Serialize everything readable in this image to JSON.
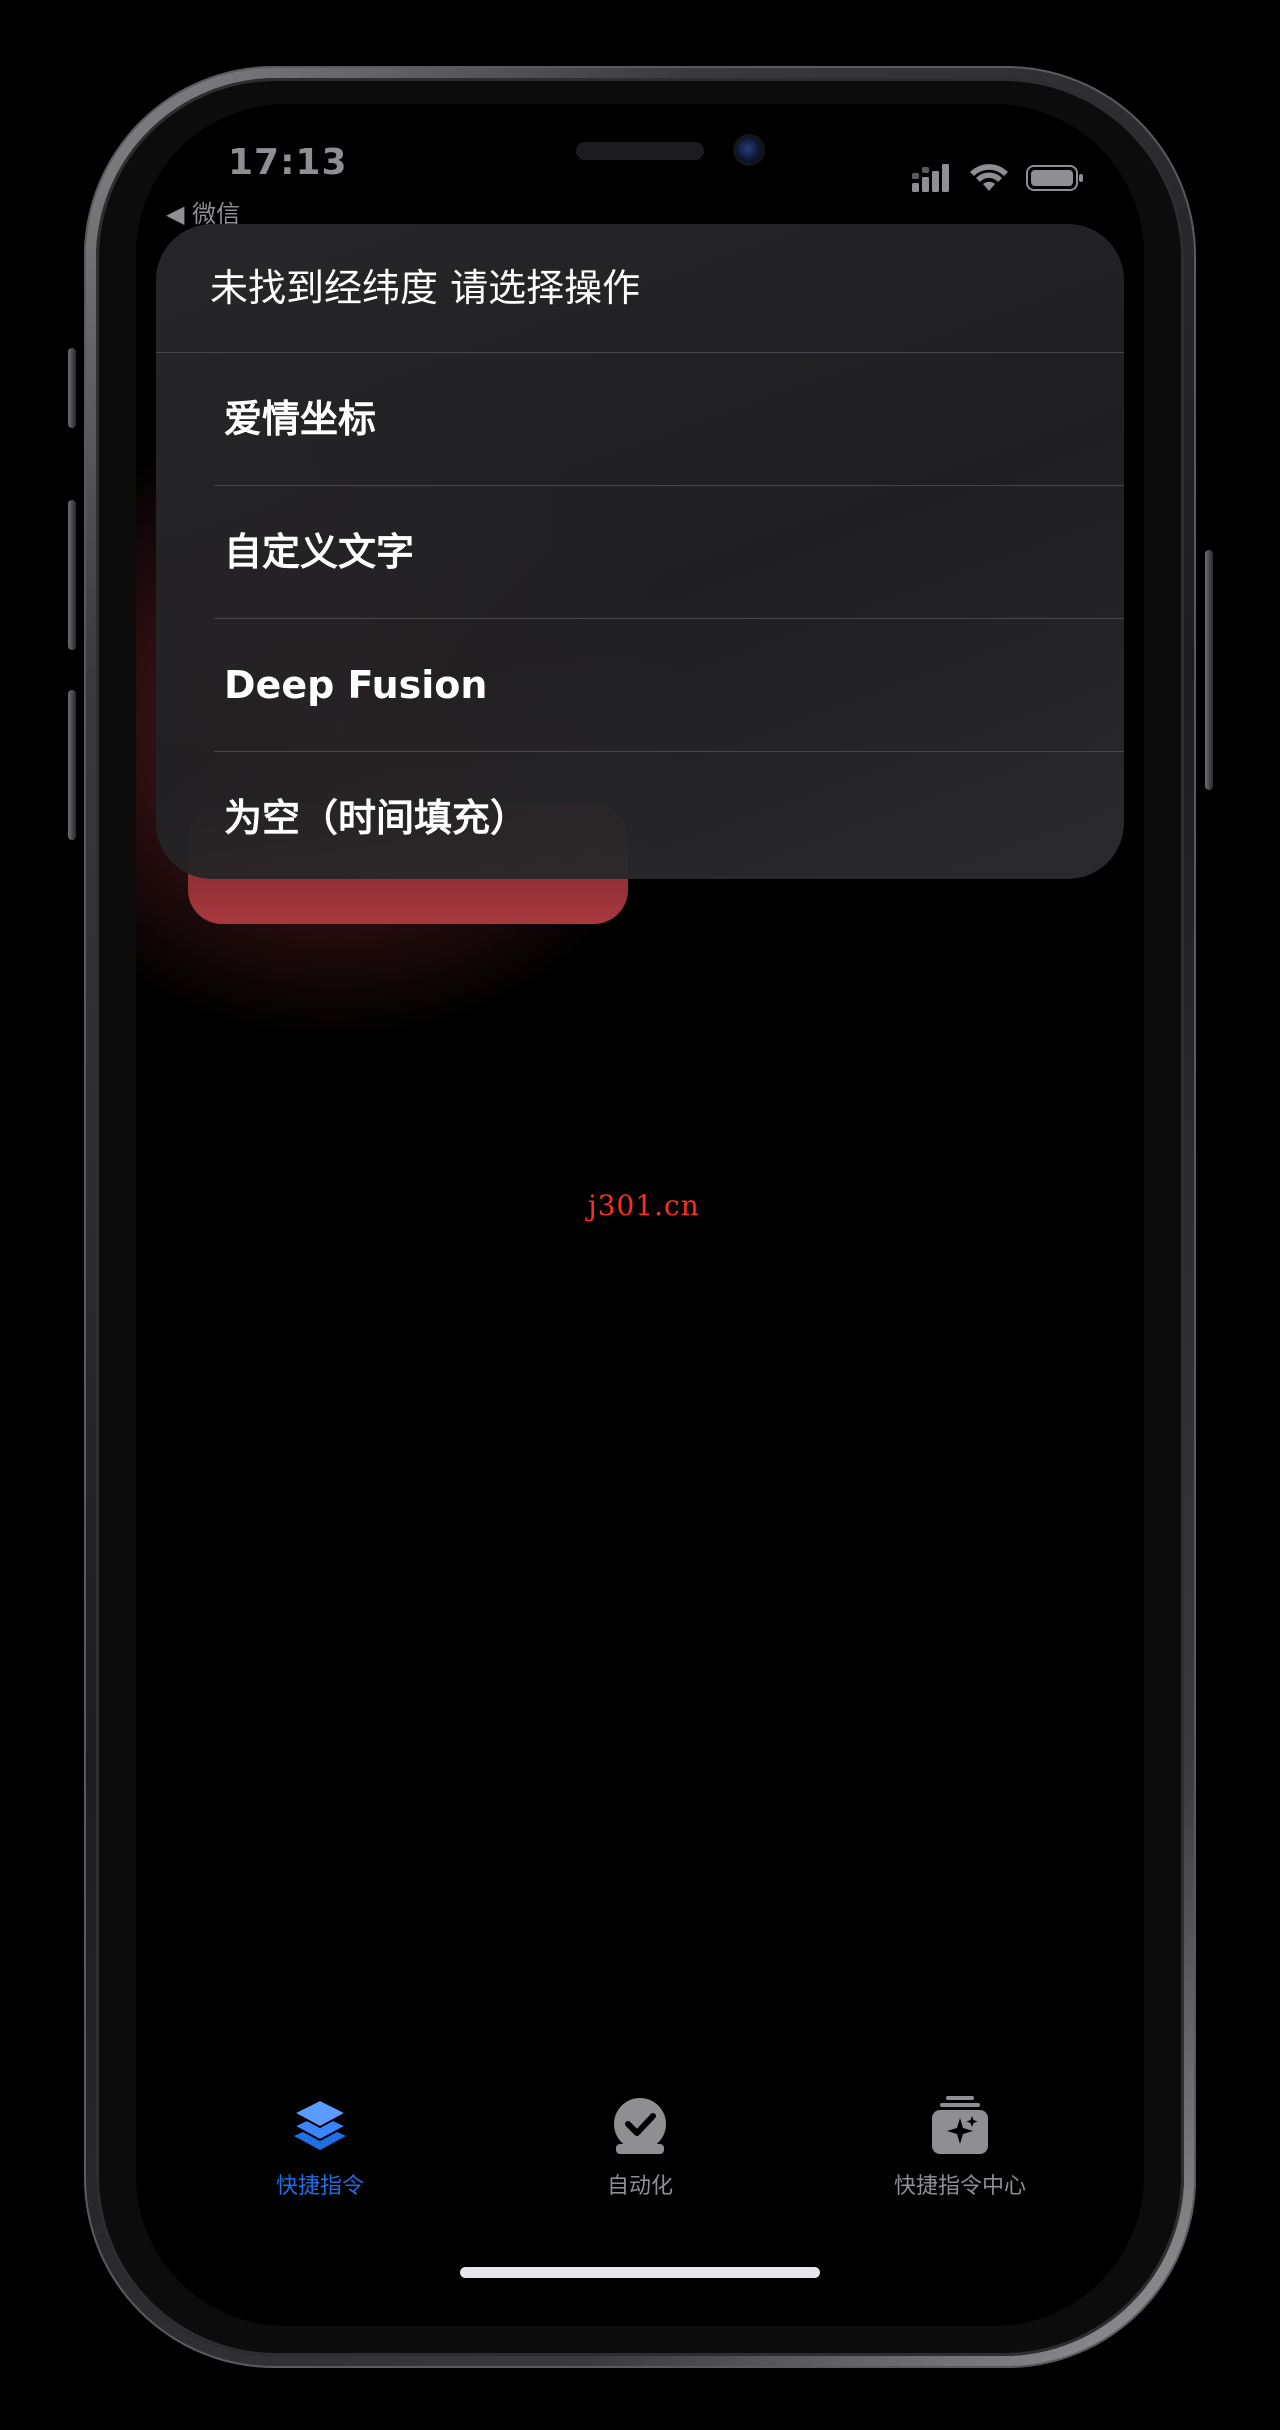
{
  "status_bar": {
    "time": "17:13",
    "back_app": "◀ 微信"
  },
  "action_sheet": {
    "title": "未找到经纬度 请选择操作",
    "options": [
      {
        "label": "爱情坐标"
      },
      {
        "label": "自定义文字"
      },
      {
        "label": "Deep Fusion"
      },
      {
        "label": "为空（时间填充）"
      }
    ]
  },
  "watermark": "j301.cn",
  "tab_bar": {
    "tabs": [
      {
        "label": "快捷指令",
        "icon": "layers-icon",
        "active": true
      },
      {
        "label": "自动化",
        "icon": "clock-check-icon",
        "active": false
      },
      {
        "label": "快捷指令中心",
        "icon": "gallery-sparkle-icon",
        "active": false
      }
    ]
  },
  "colors": {
    "accent": "#1f6ee6",
    "inactive": "#8e8e93",
    "watermark": "#ff2d20"
  }
}
